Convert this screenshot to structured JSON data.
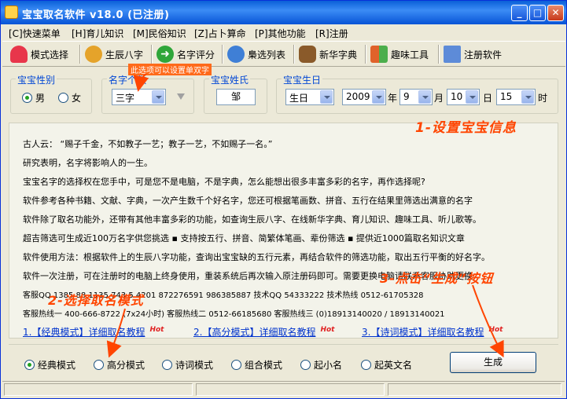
{
  "window": {
    "title": "宝宝取名软件  v18.0 (已注册)",
    "buttons": {
      "minimize": "_",
      "maximize": "□",
      "close": "✕"
    }
  },
  "menu": [
    "[C]快速菜单",
    "[H]育儿知识",
    "[M]民俗知识",
    "[Z]占卜算命",
    "[P]其他功能",
    "[R]注册"
  ],
  "toolbar": [
    {
      "label": "模式选择",
      "icon": "heart-icon",
      "color": "#e8364b"
    },
    {
      "label": "生辰八字",
      "icon": "family-icon",
      "color": "#e5a32a"
    },
    {
      "label": "名字评分",
      "icon": "arrow-right-icon",
      "color": "#2fa63a"
    },
    {
      "label": "梟选列表",
      "icon": "globe-icon",
      "color": "#3f7fd6"
    },
    {
      "label": "新华字典",
      "icon": "scholar-icon",
      "color": "#8a5a2a"
    },
    {
      "label": "趣味工具",
      "icon": "windows-logo-icon",
      "color": "#e0622a"
    },
    {
      "label": "注册软件",
      "icon": "monitor-icon",
      "color": "#5d8bd8"
    }
  ],
  "form": {
    "gender": {
      "title": "宝宝性别",
      "options": [
        "男",
        "女"
      ],
      "selected": "男"
    },
    "name_length": {
      "title": "名字个数",
      "value": "三字"
    },
    "surname": {
      "title": "宝宝姓氏",
      "value": "邹"
    },
    "birth": {
      "title": "宝宝生日",
      "calendar": "生日",
      "year": "2009",
      "year_unit": "年",
      "month": "9",
      "month_unit": "月",
      "day": "10",
      "day_unit": "日",
      "hour": "15",
      "hour_unit": "时"
    }
  },
  "info_lines": [
    "古人云：  “赐子千金，不如教子一艺；教子一艺，不如赐子一名。”",
    "研究表明，名字将影响人的一生。",
    "宝宝名字的选择权在您手中，可是您不是电脑，不是字典，怎么能想出很多丰富多彩的名字，再作选择呢?",
    "软件参考各种书籍、文献、字典，一次产生数千个好名字，您还可根据笔画数、拼音、五行在结果里筛选出满意的名字",
    "软件除了取名功能外，还带有其他丰富多彩的功能，如查询生辰八字、在线新华字典、育儿知识、趣味工具、听儿歌等。",
    "超吉筛选可生成近100万名字供您挑选   ▪  支持按五行、拼音、简繁体笔画、辈份筛选   ▪  提供近1000篇取名知识文章",
    "软件使用方法：根据软件上的生辰八字功能，查询出宝宝缺的五行元素，再结合软件的筛选功能，取出五行平衡的好名字。",
    "软件一次注册，可在注册时的电脑上终身使用，重装系统后再次输入原注册码即可。需要更换电脑请联系客服协助更换",
    "客服QQ  1385     88  1135    743   5     4201   872276591   986385887   技术QQ 54333222   技术热线 0512-61705328",
    "客服热线一  400-666-8722 (7x24小时)   客服热线二 0512-66185680   客服热线三  (0)18913140020 / 18913140021"
  ],
  "tutorials": [
    {
      "label": "1.【经典模式】详细取名教程",
      "badge": "Hot"
    },
    {
      "label": "2.【高分模式】详细取名教程",
      "badge": "Hot"
    },
    {
      "label": "3.【诗词模式】详细取名教程",
      "badge": "Hot"
    }
  ],
  "modes": {
    "options": [
      "经典模式",
      "高分模式",
      "诗词模式",
      "组合模式",
      "起小名",
      "起英文名"
    ],
    "selected": "经典模式"
  },
  "generate_button": "生成",
  "annotations": {
    "step1": "1-设置宝宝信息",
    "step2": "2-选择取名模式",
    "step3": "3-点击“生成”按钮",
    "note": "此选项可以设置单双字"
  }
}
